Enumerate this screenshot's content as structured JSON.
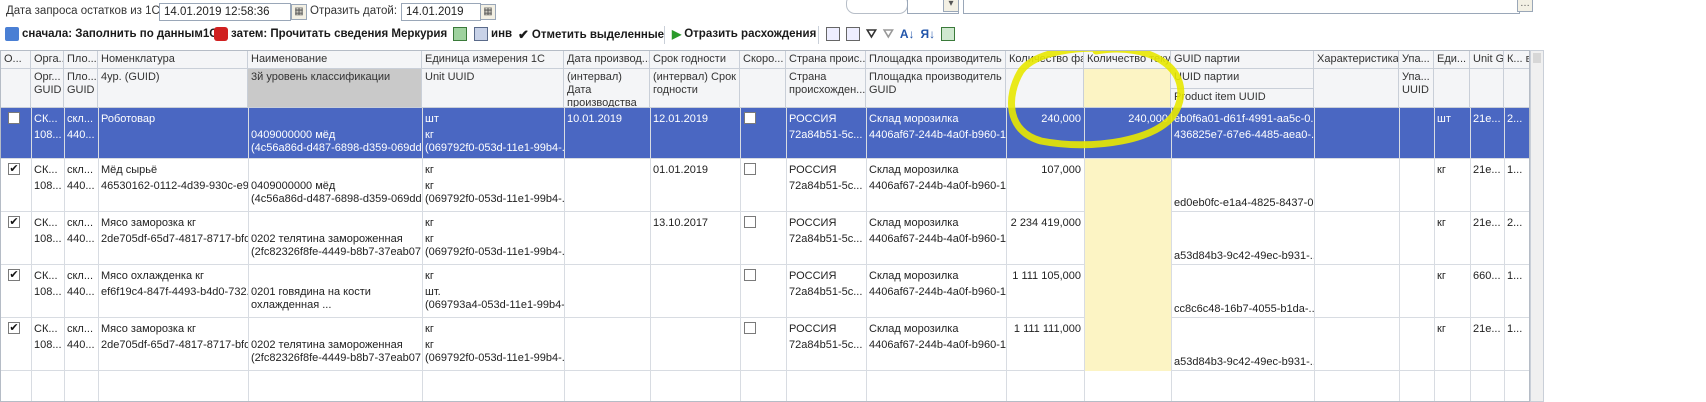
{
  "toolbar": {
    "date_request_label": "Дата запроса остатков из 1С:",
    "date_request_value": "14.01.2019 12:58:36",
    "reflect_date_label": "Отразить датой:",
    "reflect_date_value": "14.01.2019",
    "step1_label": "сначала: Заполнить по данным1С",
    "step2_label": "затем: Прочитать сведения Меркурия",
    "inv_label": "инв",
    "mark_label": "Отметить выделенные",
    "reflect_diff_label": "Отразить расхождения"
  },
  "columns_top": [
    "О...",
    "Орга...",
    "Пло...",
    "Номенклатура",
    "Наименование",
    "Единица измерения 1С",
    "Дата производ...",
    "Срок годности",
    "Скоро...",
    "Страна проис...",
    "Площадка производитель",
    "Количество фактическое",
    "Количество текущее меркурий",
    "GUID партии",
    "Характеристика номенклатуры",
    "Упа...",
    "Еди... изм... по...",
    "Unit GUID",
    "К... в д..."
  ],
  "columns_sub": [
    "",
    "Орг... GUID",
    "Пло... GUID",
    "4ур. (GUID)",
    "3й уровень классификации",
    "Unit UUID",
    "(интервал) Дата производства",
    "(интервал) Срок годности",
    "",
    "Страна происхожден...",
    "Площадка производитель GUID",
    "",
    "",
    "UUID партии",
    "",
    "Упа... UUID",
    "",
    "",
    ""
  ],
  "columns_sub2": {
    "guid_batch": "Product item UUID"
  },
  "rows": [
    {
      "checked": false,
      "org": "СК...",
      "org_guid": "108...",
      "pl": "скл...",
      "pl_guid": "440...",
      "nom": "Роботовар",
      "nom_guid": "",
      "name_cls": "0409000000 мёд",
      "name_guid": "(4c56a86d-d487-6898-d359-069ddc...",
      "unit": "шт",
      "unit_guid": "кг",
      "unit_uuid": "(069792f0-053d-11e1-99b4-...",
      "date_prod": "10.01.2019",
      "exp": "12.01.2019",
      "fast": false,
      "country": "РОССИЯ",
      "country_guid": "72a84b51-5c...",
      "site": "Склад морозилка",
      "site_guid": "4406af67-244b-4a0f-b960-1...",
      "qty_fact": "240,000",
      "qty_merc": "240,000",
      "batch": "eb0f6a01-d61f-4991-aa5c-0...",
      "batch2": "436825e7-67e6-4485-aea0-...",
      "char": "",
      "upa": "",
      "unit2": "шт",
      "unitguid": "21е...",
      "k": "2..."
    },
    {
      "checked": true,
      "org": "СК...",
      "org_guid": "108...",
      "pl": "скл...",
      "pl_guid": "440...",
      "nom": "Мёд сырьё",
      "nom_guid": "46530162-0112-4d39-930c-e9...",
      "name_cls": "0409000000 мёд",
      "name_guid": "(4c56a86d-d487-6898-d359-069ddc...",
      "unit": "кг",
      "unit_guid": "кг",
      "unit_uuid": "(069792f0-053d-11e1-99b4-...",
      "date_prod": "",
      "exp": "01.01.2019",
      "fast": false,
      "country": "РОССИЯ",
      "country_guid": "72a84b51-5c...",
      "site": "Склад морозилка",
      "site_guid": "4406af67-244b-4a0f-b960-1...",
      "qty_fact": "107,000",
      "qty_merc": "",
      "batch": "",
      "batch2": "ed0eb0fc-e1a4-4825-8437-0...",
      "char": "",
      "upa": "",
      "unit2": "кг",
      "unitguid": "21е...",
      "k": "1..."
    },
    {
      "checked": true,
      "org": "СК...",
      "org_guid": "108...",
      "pl": "скл...",
      "pl_guid": "440...",
      "nom": "Мясо заморозка кг",
      "nom_guid": "2de705df-65d7-4817-8717-bfd...",
      "name_cls": "0202 телятина замороженная",
      "name_guid": "(2fc82326f8fe-4449-b8b7-37eab07...",
      "unit": "кг",
      "unit_guid": "кг",
      "unit_uuid": "(069792f0-053d-11e1-99b4-...",
      "date_prod": "",
      "exp": "13.10.2017",
      "fast": false,
      "country": "РОССИЯ",
      "country_guid": "72a84b51-5c...",
      "site": "Склад морозилка",
      "site_guid": "4406af67-244b-4a0f-b960-1...",
      "qty_fact": "2 234 419,000",
      "qty_merc": "",
      "batch": "",
      "batch2": "a53d84b3-9c42-49ec-b931-...",
      "char": "",
      "upa": "",
      "unit2": "кг",
      "unitguid": "21е...",
      "k": "2..."
    },
    {
      "checked": true,
      "org": "СК...",
      "org_guid": "108...",
      "pl": "скл...",
      "pl_guid": "440...",
      "nom": "Мясо охлажденка кг",
      "nom_guid": "ef6f19c4-847f-4493-b4d0-732...",
      "name_cls": "0201 говядина на кости",
      "name_guid": "охлажденная ...",
      "unit": "кг",
      "unit_guid": "шт.",
      "unit_uuid": "(069793a4-053d-11e1-99b4-...",
      "date_prod": "",
      "exp": "",
      "fast": false,
      "country": "РОССИЯ",
      "country_guid": "72a84b51-5c...",
      "site": "Склад морозилка",
      "site_guid": "4406af67-244b-4a0f-b960-1...",
      "qty_fact": "1 111 105,000",
      "qty_merc": "",
      "batch": "",
      "batch2": "cc8c6c48-16b7-4055-b1da-...",
      "char": "",
      "upa": "",
      "unit2": "кг",
      "unitguid": "660...",
      "k": "1..."
    },
    {
      "checked": true,
      "org": "СК...",
      "org_guid": "108...",
      "pl": "скл...",
      "pl_guid": "440...",
      "nom": "Мясо заморозка кг",
      "nom_guid": "2de705df-65d7-4817-8717-bfd...",
      "name_cls": "0202 телятина замороженная",
      "name_guid": "(2fc82326f8fe-4449-b8b7-37eab07...",
      "unit": "кг",
      "unit_guid": "кг",
      "unit_uuid": "(069792f0-053d-11e1-99b4-...",
      "date_prod": "",
      "exp": "",
      "fast": false,
      "country": "РОССИЯ",
      "country_guid": "72a84b51-5c...",
      "site": "Склад морозилка",
      "site_guid": "4406af67-244b-4a0f-b960-1...",
      "qty_fact": "1 111 111,000",
      "qty_merc": "",
      "batch": "",
      "batch2": "a53d84b3-9c42-49ec-b931-...",
      "char": "",
      "upa": "",
      "unit2": "кг",
      "unitguid": "21е...",
      "k": "1..."
    }
  ],
  "colors": {
    "selected_row": "#4a67c2",
    "highlight_col": "#fcf4c4",
    "annotation": "#e8e800"
  }
}
